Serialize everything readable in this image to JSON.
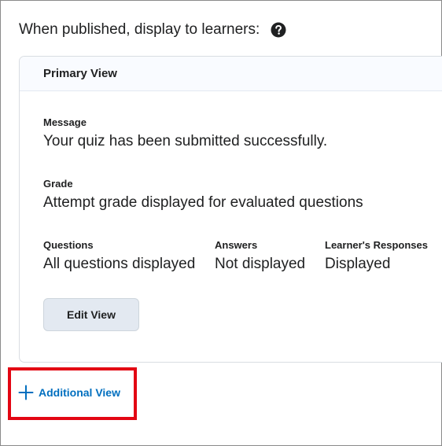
{
  "section": {
    "heading": "When published, display to learners:",
    "help_icon": "question-circle-icon"
  },
  "primary_view": {
    "title": "Primary View",
    "message_label": "Message",
    "message_value": "Your quiz has been submitted successfully.",
    "grade_label": "Grade",
    "grade_value": "Attempt grade displayed for evaluated questions",
    "questions_label": "Questions",
    "questions_value": "All questions displayed",
    "answers_label": "Answers",
    "answers_value": "Not displayed",
    "responses_label": "Learner's Responses",
    "responses_value": "Displayed",
    "edit_button": "Edit View"
  },
  "additional_view": {
    "label": "Additional View",
    "icon": "plus-icon"
  },
  "colors": {
    "link": "#006fbf",
    "highlight": "#e30613",
    "button_bg": "#e3e9f1"
  }
}
